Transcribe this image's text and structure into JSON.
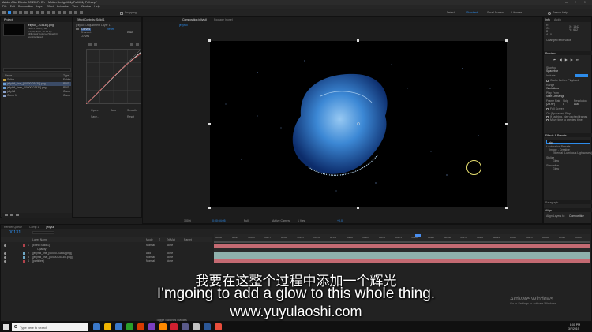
{
  "window": {
    "title": "Adobe After Effects CC 2017 - D:\\~~Motion Design\\Jelly Full\\Jelly Full.aep *",
    "controls": [
      "—",
      "□",
      "✕"
    ]
  },
  "menubar": [
    "File",
    "Edit",
    "Composition",
    "Layer",
    "Effect",
    "Animation",
    "View",
    "Window",
    "Help"
  ],
  "toolbar": {
    "snapping_label": "Snapping",
    "workspaces": [
      "Default",
      "Standard",
      "Small Screen",
      "Libraries"
    ],
    "search_placeholder": "Search Help"
  },
  "project_panel": {
    "tab": "Project",
    "selected_name": "jellyfull_...03430].png",
    "info_lines": [
      "1920 x 1080 (1.00)",
      "Δ 0;00;15;00, 29.97 fps",
      "Millions of Colors+ (Straight)",
      "non-interlaced"
    ],
    "columns": [
      "Name",
      "Type"
    ],
    "items": [
      {
        "name": "Solids",
        "type": "Folder",
        "color": "#c9a33d"
      },
      {
        "name": "jellyfull_final_[00000-03430].png",
        "type": "PNG",
        "color": "#6a9fd6"
      },
      {
        "name": "jellyfull_fines_[00000-03430].png",
        "type": "PNG",
        "color": "#6a9fd6"
      },
      {
        "name": "jellyfull",
        "type": "Comp",
        "color": "#8aa0c8"
      },
      {
        "name": "Comp 1",
        "type": "Comp",
        "color": "#8aa0c8"
      }
    ]
  },
  "effect_controls": {
    "tab": "Effect Controls: Solid 1",
    "layer_label": "jellyfull • Adjustment Layer 1",
    "effect_name": "Curves",
    "reset_label": "Reset",
    "channel_label": "Channel:",
    "channel_value": "RGB",
    "curves_label": "Curves",
    "bottom_buttons": [
      "Open...",
      "Auto",
      "Smooth",
      "Save...",
      "Reset"
    ]
  },
  "composition": {
    "tab": "Composition jellyfull",
    "tab2": "Footage (none)",
    "breadcrumb": "jellyfull",
    "zoom": "100%",
    "time": "0;00;04;05",
    "resolution": "Full",
    "camera": "Active Camera",
    "views": "1 View",
    "offset": "+0.0"
  },
  "right_panel": {
    "info_tab": "Info",
    "audio_tab": "Audio",
    "info_lines": [
      "R :",
      "G :",
      "B :",
      "A : 0"
    ],
    "info_xy": [
      "X : 1542",
      "Y : 612"
    ],
    "change_label": "Change Effect Value",
    "preview_tab": "Preview",
    "shortcut_label": "Shortcut",
    "shortcut_value": "Spacebar",
    "include_label": "Include:",
    "cache_label": "Cache Before Playback",
    "range_label": "Range",
    "range_value": "Work Area",
    "playfrom_label": "Play From",
    "playfrom_value": "Start Of Range",
    "framerate_label": "Frame Rate",
    "skip_label": "Skip",
    "resolution_label": "Resolution",
    "framerate_value": "(29.97)",
    "skip_value": "0",
    "resolution_value": "Auto",
    "fullscreen_label": "Full Screen",
    "stop_label": "On (Spacebar) Stop:",
    "stop_opt1": "If caching, play cached frames",
    "stop_opt2": "Move time to preview time",
    "effects_tab": "Effects & Presets",
    "effects_search": "glo",
    "anim_presets": "* Animation Presets",
    "preset_group": "Image - Creative",
    "preset_item": "Ethereal (Luminous Lightwaves)",
    "stylize_group": "Stylize",
    "stylize_item": "Glow",
    "sub_group": "Simulation",
    "sub_item": "Glow",
    "paragraph_tab": "Paragraph",
    "align_tab": "Align",
    "align_to_label": "Align Layers to:",
    "align_to_value": "Composition"
  },
  "timeline": {
    "tabs": [
      "Render Queue",
      "Comp 1",
      "jellyfull"
    ],
    "timecode": "00131",
    "columns": [
      "Layer Name",
      "Mode",
      "T",
      "TrkMat",
      "Parent"
    ],
    "layers": [
      {
        "num": "1",
        "name": "[Effect Solid 1]",
        "mode": "Normal",
        "parent": "None",
        "color": "#b1434c",
        "bar": "#c46a72",
        "checked": true
      },
      {
        "num": "",
        "name": "Opacity",
        "mode": "",
        "parent": "",
        "color": "#b1434c",
        "bar": "#8fa3a8",
        "checked": false
      },
      {
        "num": "2",
        "name": "[jellyfull_fine_[00000-03430].png]",
        "mode": "Add",
        "parent": "None",
        "color": "#6ea7c4",
        "bar": "#8fb0ac",
        "checked": true
      },
      {
        "num": "3",
        "name": "[jellyfull_final_[00000-03430].png]",
        "mode": "Normal",
        "parent": "None",
        "color": "#6ea7c4",
        "bar": "#8fb0ac",
        "checked": true
      },
      {
        "num": "4",
        "name": "[particles]",
        "mode": "Normal",
        "parent": "None",
        "color": "#b1434c",
        "bar": "#c46a72",
        "checked": true
      }
    ],
    "ruler": [
      "00000",
      "00025",
      "00050",
      "00075",
      "00100",
      "00125",
      "00150",
      "00175",
      "00200",
      "00225",
      "00250",
      "00275",
      "00300",
      "00325",
      "00350",
      "00375",
      "00400",
      "00425",
      "00450",
      "00475",
      "00500",
      "00525",
      "00550"
    ],
    "toggle_label": "Toggle Switches / Modes"
  },
  "subtitles": {
    "chinese": "我要在这整个过程中添加一个辉光",
    "english": "I'mgoing to add a glow to this whole thing.",
    "site": "www.yuyulaoshi.com"
  },
  "watermark": {
    "line1": "Activate Windows",
    "line2": "Go to Settings to activate Windows."
  },
  "taskbar": {
    "search_placeholder": "Type here to search",
    "time": "8:01 PM",
    "date": "3/7/2019",
    "app_colors": [
      "#3a78c9",
      "#f0b400",
      "#3a78c9",
      "#2a9f2a",
      "#d83b01",
      "#7a3fc0",
      "#ff8a00",
      "#d02030",
      "#5a5a8a",
      "#c0c0c0",
      "#2b5797",
      "#e84d3c"
    ]
  },
  "colors": {
    "accent_blue": "#2d8ceb",
    "jelly": "#3f8fe0",
    "label_red": "#b1434c",
    "label_teal": "#8fb0ac"
  }
}
